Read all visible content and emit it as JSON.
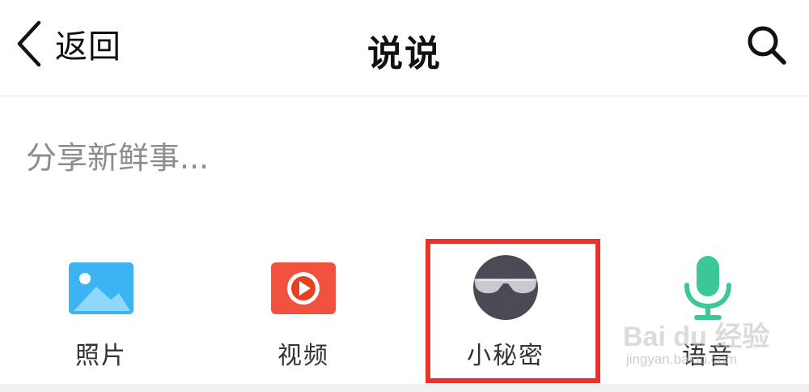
{
  "header": {
    "back_label": "返回",
    "title": "说说",
    "back_icon": "chevron-left-icon",
    "search_icon": "search-icon"
  },
  "compose": {
    "placeholder": "分享新鲜事..."
  },
  "tools": [
    {
      "label": "照片",
      "icon": "photo-icon",
      "color": "#3cb4f2"
    },
    {
      "label": "视频",
      "icon": "video-icon",
      "color": "#f1523f"
    },
    {
      "label": "小秘密",
      "icon": "secret-icon",
      "color": "#4a4a55"
    },
    {
      "label": "语音",
      "icon": "microphone-icon",
      "color": "#3cc79a"
    }
  ],
  "highlight": {
    "color": "#e8322e",
    "target": "小秘密"
  },
  "watermark": {
    "text": "Bai du 经验",
    "url": "jingyan.baidu.com"
  }
}
